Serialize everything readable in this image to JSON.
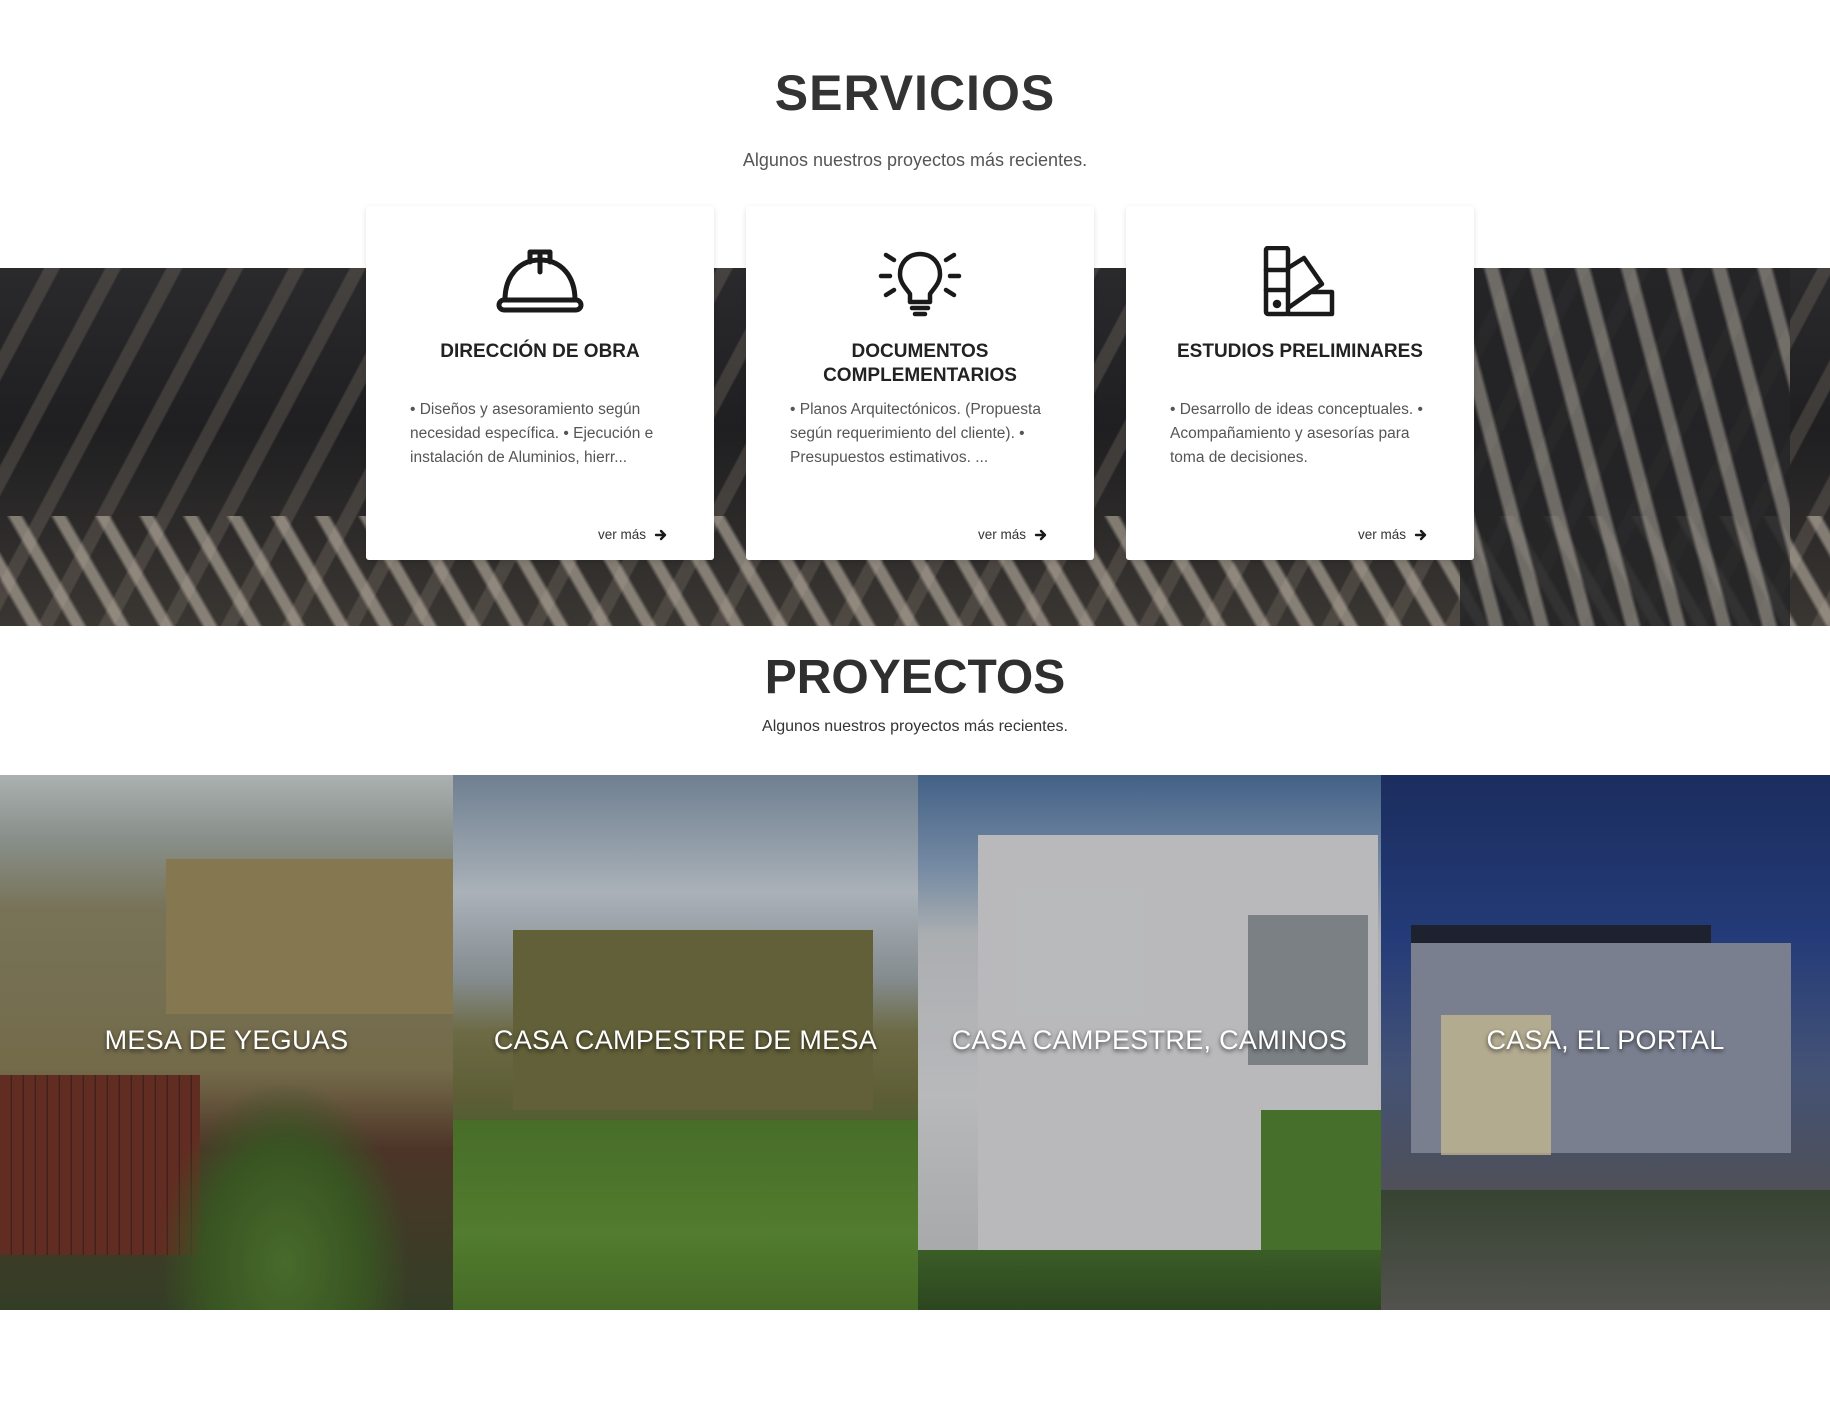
{
  "servicios": {
    "title": "SERVICIOS",
    "subtitle": "Algunos nuestros proyectos más recientes.",
    "cards": [
      {
        "icon": "hard-hat-icon",
        "title": "DIRECCIÓN DE OBRA",
        "text": "• Diseños y asesoramiento según necesidad específica. • Ejecución e instalación de Aluminios, hierr...",
        "link": "ver más"
      },
      {
        "icon": "lightbulb-icon",
        "title": "DOCUMENTOS COMPLEMENTARIOS",
        "text": "• Planos Arquitectónicos. (Propuesta según requerimiento del cliente). • Presupuestos estimativos. ...",
        "link": "ver más"
      },
      {
        "icon": "color-swatch-icon",
        "title": "ESTUDIOS PRELIMINARES",
        "text": "• Desarrollo de ideas conceptuales. • Acompañamiento y asesorías para toma de decisiones.",
        "link": "ver más"
      }
    ]
  },
  "proyectos": {
    "title": "PROYECTOS",
    "subtitle": "Algunos nuestros proyectos más recientes.",
    "items": [
      {
        "title": "MESA DE YEGUAS"
      },
      {
        "title": "CASA CAMPESTRE DE MESA"
      },
      {
        "title": "CASA CAMPESTRE, CAMINOS"
      },
      {
        "title": "CASA, EL PORTAL"
      }
    ]
  }
}
